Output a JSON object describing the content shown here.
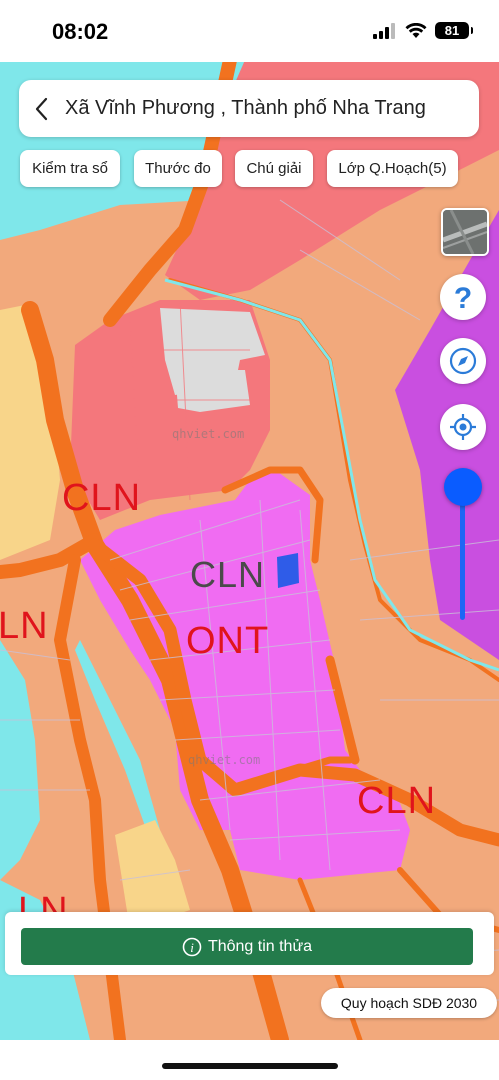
{
  "status_bar": {
    "time": "08:02",
    "battery": "81"
  },
  "header": {
    "title": "Xã Vĩnh Phương , Thành phố Nha Trang",
    "back_icon": "chevron-left-icon"
  },
  "toolbar": [
    {
      "label": "Kiểm tra sổ"
    },
    {
      "label": "Thước đo"
    },
    {
      "label": "Chú giải"
    },
    {
      "label": "Lớp Q.Hoạch(5)"
    }
  ],
  "side_controls": {
    "layer_icon": "satellite-thumbnail-icon",
    "help_icon": "question-icon",
    "compass_icon": "compass-icon",
    "locate_icon": "locate-icon",
    "opacity_level": 1.0
  },
  "map": {
    "zone_labels": [
      {
        "text": "CLN"
      },
      {
        "text": "CLN"
      },
      {
        "text": "ONT"
      },
      {
        "text": "LN"
      },
      {
        "text": "CLN"
      },
      {
        "text": "LN"
      }
    ],
    "watermark": "qhviet.com",
    "colors": {
      "cln": "#f2a97c",
      "ont": "#f06cf2",
      "rivers": "#7fe7ea",
      "roads": "#f2721f",
      "forest": "#c94fe0",
      "residential_red": "#f4777c",
      "label": "#e0141c"
    }
  },
  "bottom": {
    "info_button": "Thông tin thửa",
    "plan_label": "Quy hoạch SDĐ 2030"
  }
}
